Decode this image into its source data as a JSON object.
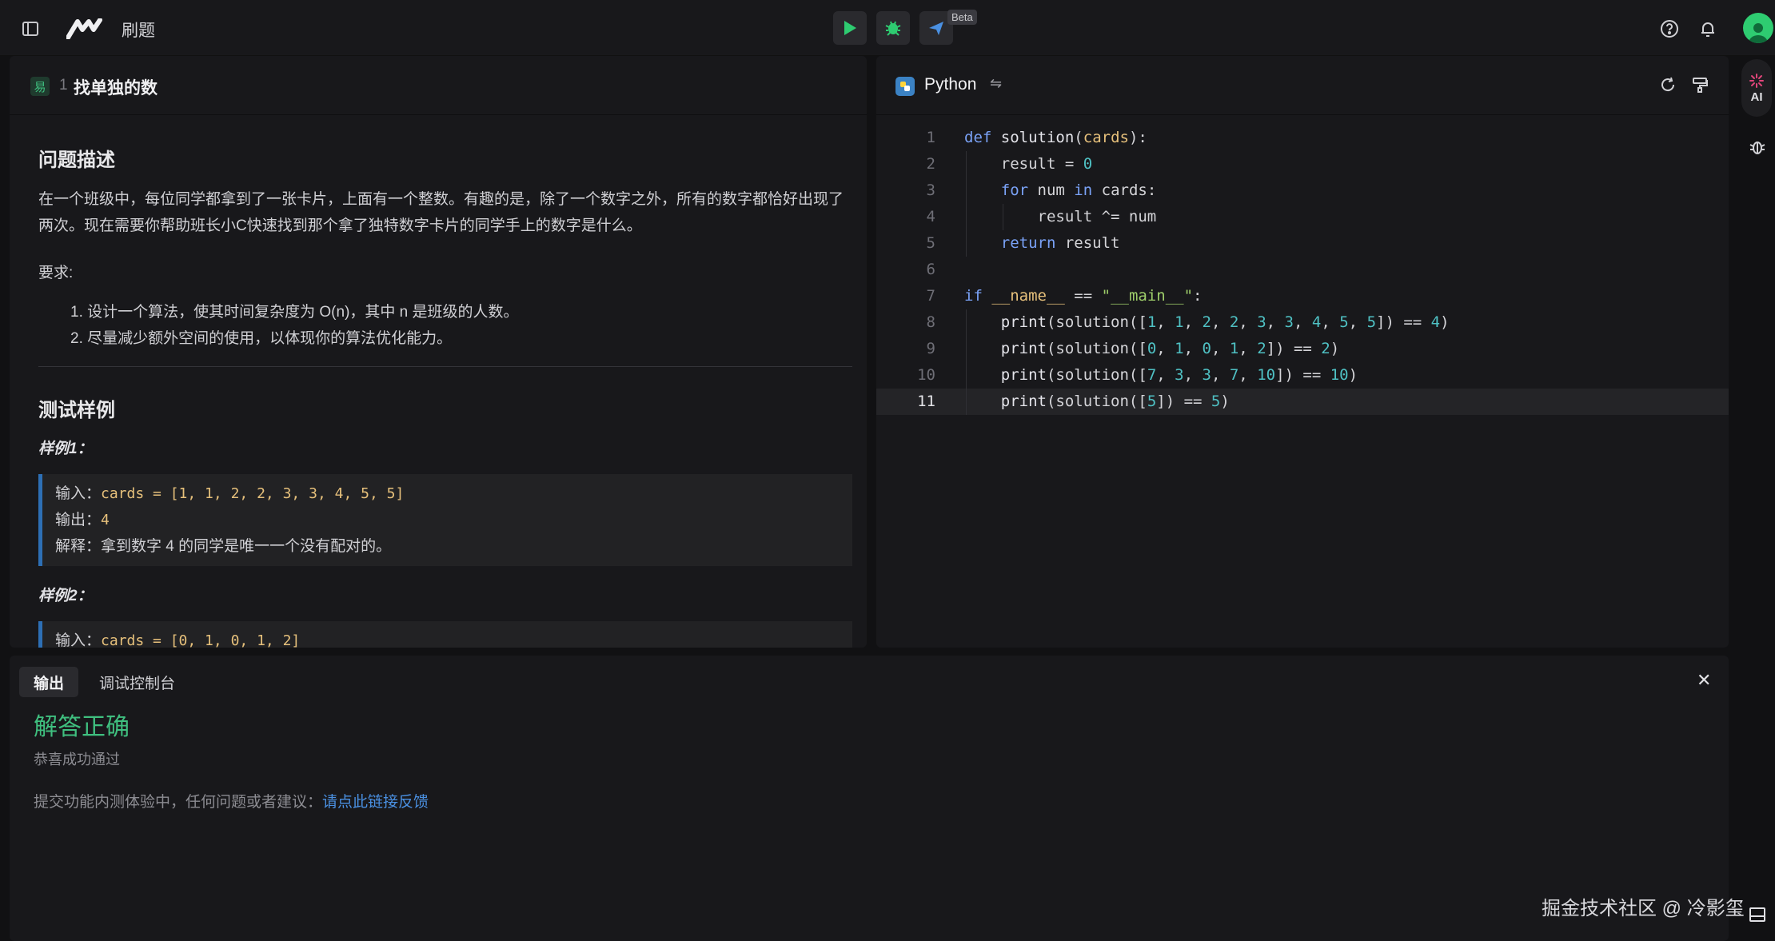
{
  "topbar": {
    "title": "刷题",
    "beta_badge": "Beta"
  },
  "problem": {
    "difficulty": "易",
    "number": "1",
    "title": "找单独的数",
    "section_description": "问题描述",
    "description": "在一个班级中，每位同学都拿到了一张卡片，上面有一个整数。有趣的是，除了一个数字之外，所有的数字都恰好出现了两次。现在需要你帮助班长小C快速找到那个拿了独特数字卡片的同学手上的数字是什么。",
    "requirements_label": "要求:",
    "requirements": [
      "1. 设计一个算法，使其时间复杂度为 O(n)，其中 n 是班级的人数。",
      "2. 尽量减少额外空间的使用，以体现你的算法优化能力。"
    ],
    "section_examples": "测试样例",
    "examples": [
      {
        "title": "样例1：",
        "input_label": "输入：",
        "input": "cards = [1, 1, 2, 2, 3, 3, 4, 5, 5]",
        "output_label": "输出：",
        "output": "4",
        "explain_label": "解释：",
        "explain": "拿到数字 4 的同学是唯一一个没有配对的。"
      },
      {
        "title": "样例2：",
        "input_label": "输入：",
        "input": "cards = [0, 1, 0, 1, 2]"
      }
    ]
  },
  "editor": {
    "language": "Python",
    "line_numbers": [
      "1",
      "2",
      "3",
      "4",
      "5",
      "6",
      "7",
      "8",
      "9",
      "10",
      "11"
    ],
    "active_line": 11
  },
  "output": {
    "tabs": [
      "输出",
      "调试控制台"
    ],
    "result_title": "解答正确",
    "result_subtitle": "恭喜成功通过",
    "feedback_text": "提交功能内测体验中，任何问题或者建议：",
    "feedback_link": "请点此链接反馈"
  },
  "sidebar": {
    "ai_label": "AI"
  },
  "watermark": "掘金技术社区 @ 冷影玺",
  "colors": {
    "accent_green": "#3fbf7f",
    "link_blue": "#4a90e2",
    "keyword_blue": "#7aa2f7",
    "number_teal": "#4fc1c4",
    "string_green": "#9ece6a"
  }
}
